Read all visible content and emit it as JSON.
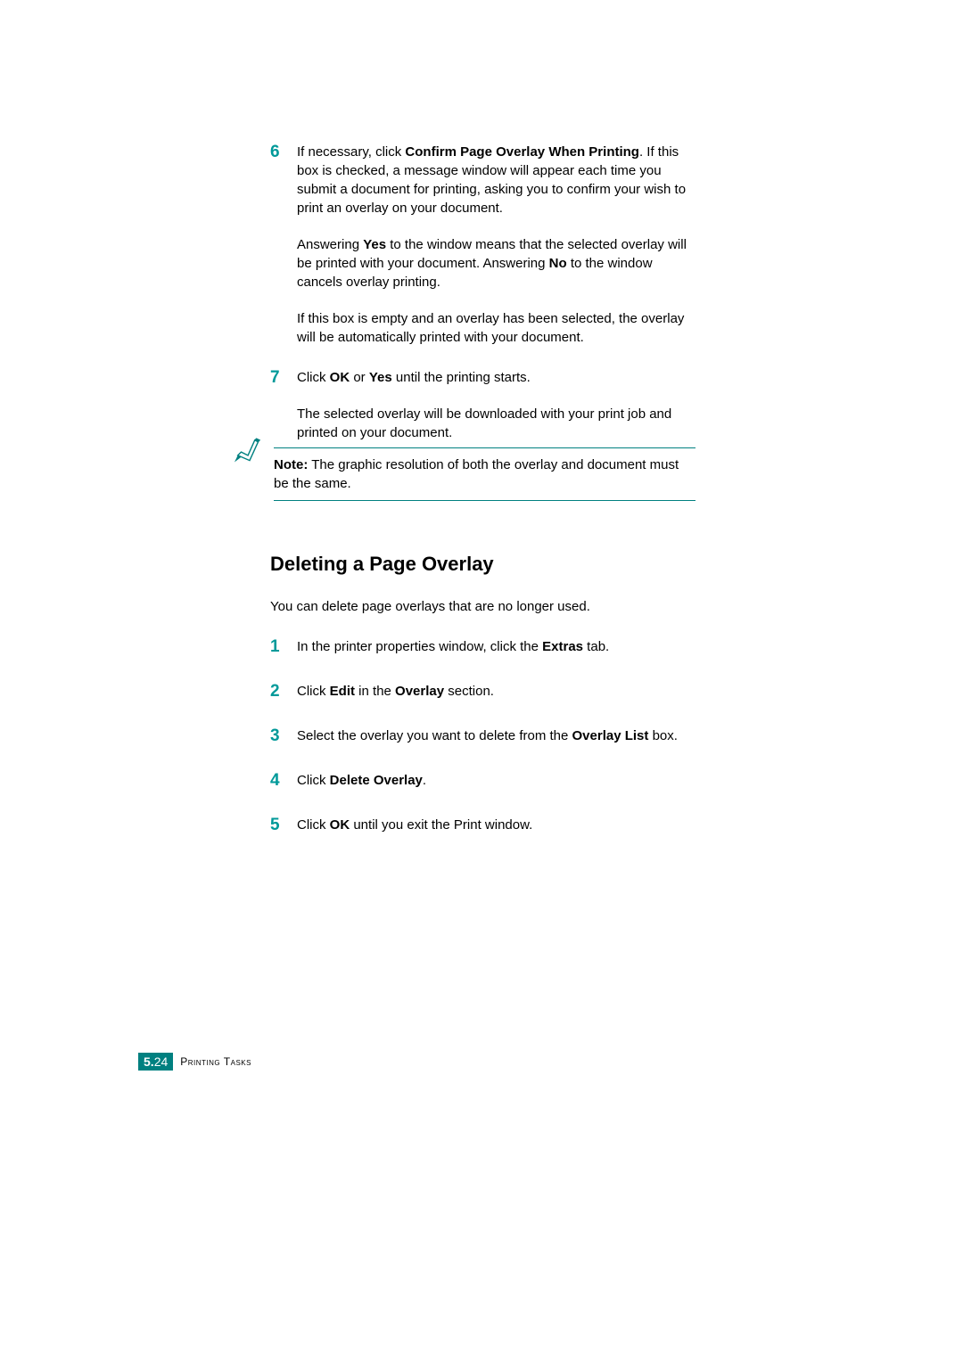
{
  "steps_a": {
    "step6": {
      "num": "6",
      "p1_a": "If necessary, click ",
      "p1_b": "Confirm Page Overlay When Printing",
      "p1_c": ". If this box is checked, a message window will appear each time you submit a document for printing, asking you to confirm your wish to print an overlay on your document.",
      "p2_a": "Answering ",
      "p2_b": "Yes",
      "p2_c": " to the window means that the selected overlay will be printed with your document. Answering ",
      "p2_d": "No",
      "p2_e": " to the window cancels overlay printing.",
      "p3": "If this box is empty and an overlay has been selected, the overlay will be automatically printed with your document."
    },
    "step7": {
      "num": "7",
      "p1_a": "Click ",
      "p1_b": "OK",
      "p1_c": " or ",
      "p1_d": "Yes",
      "p1_e": " until the printing starts.",
      "p2": "The selected overlay will be downloaded with your print job and printed on your document."
    }
  },
  "note": {
    "label": "Note:",
    "text": " The graphic resolution of both the overlay and document must be the same."
  },
  "heading": "Deleting a Page Overlay",
  "intro": "You can delete page overlays that are no longer used.",
  "steps_b": {
    "s1": {
      "num": "1",
      "a": "In the printer properties window, click the ",
      "b": "Extras",
      "c": " tab."
    },
    "s2": {
      "num": "2",
      "a": "Click ",
      "b": "Edit",
      "c": " in the ",
      "d": "Overlay",
      "e": " section."
    },
    "s3": {
      "num": "3",
      "a": "Select the overlay you want to delete from the ",
      "b": "Overlay List",
      "c": " box."
    },
    "s4": {
      "num": "4",
      "a": "Click ",
      "b": "Delete Overlay",
      "c": "."
    },
    "s5": {
      "num": "5",
      "a": "Click ",
      "b": "OK",
      "c": " until you exit the Print window."
    }
  },
  "footer": {
    "chapter": "5.",
    "page": "24",
    "text": "Printing Tasks"
  }
}
